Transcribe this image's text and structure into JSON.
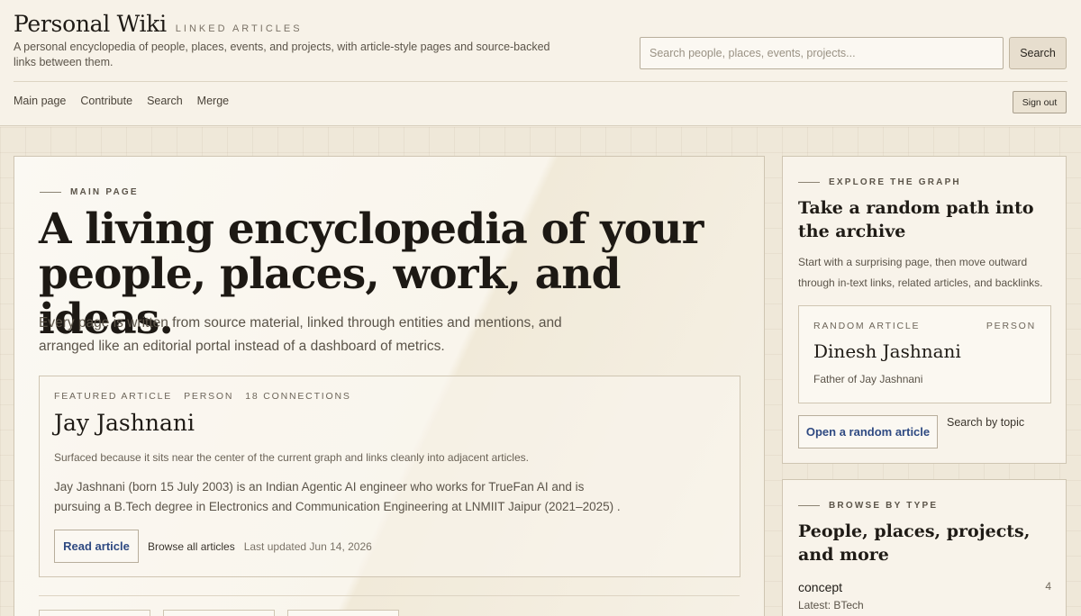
{
  "header": {
    "title": "Personal Wiki",
    "tagline": "Linked articles",
    "description": "A personal encyclopedia of people, places, events, and projects, with article-style pages and source-backed links between them.",
    "search_placeholder": "Search people, places, events, projects...",
    "search_label": "Search",
    "sign_out": "Sign out"
  },
  "nav": {
    "items": [
      "Main page",
      "Contribute",
      "Search",
      "Merge"
    ]
  },
  "hero": {
    "kicker": "Main page",
    "title": "A living encyclopedia of your people, places, work, and ideas.",
    "subtitle": "Every page is written from source material, linked through entities and mentions, and arranged like an editorial portal instead of a dashboard of metrics."
  },
  "featured": {
    "label": "Featured article",
    "type": "Person",
    "connections": "18 connections",
    "name": "Jay Jashnani",
    "reason": "Surfaced because it sits near the center of the current graph and links cleanly into adjacent articles.",
    "summary": "Jay Jashnani (born 15 July 2003) is an Indian Agentic AI engineer who works for TrueFan AI and is pursuing a B.Tech degree in Electronics and Communication Engineering at LNMIIT Jaipur (2021–2025) .",
    "read_label": "Read article",
    "browse_label": "Browse all articles",
    "updated": "Last updated Jun 14, 2026"
  },
  "explore": {
    "kicker": "Explore the graph",
    "title": "Take a random path into the archive",
    "description": "Start with a surprising page, then move outward through in-text links, related articles, and backlinks.",
    "card_label": "Random article",
    "card_type": "Person",
    "card_name": "Dinesh Jashnani",
    "card_desc": "Father of Jay Jashnani",
    "random_label": "Open a random article",
    "topic_label": "Search by topic"
  },
  "browse": {
    "kicker": "Browse by type",
    "title": "People, places, projects, and more",
    "rows": [
      {
        "label": "concept",
        "count": "4",
        "latest": "Latest: BTech"
      }
    ]
  },
  "colors": {
    "background": "#efe8d9",
    "panel": "#f8f3ea",
    "accent_link": "#2f4a82",
    "border": "#cfc5b2"
  }
}
